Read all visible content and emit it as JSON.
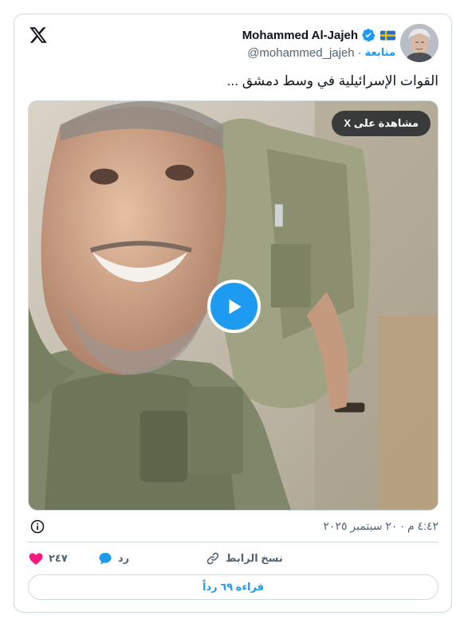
{
  "author": {
    "display_name": "Mohammed Al-Jajeh",
    "handle": "@mohammed_jajeh",
    "follow_label": "متابعة",
    "separator": "·"
  },
  "tweet": {
    "text": "القوات الإسرائيلية في وسط دمشق ..."
  },
  "media": {
    "watch_on_x_label": "مشاهدة على X"
  },
  "meta": {
    "timestamp": "٤:٤٢ م · ٢٠ سبتمبر ٢٠٢٥"
  },
  "actions": {
    "like_count": "٢٤٧",
    "reply_label": "رد",
    "copy_link_label": "نسخ الرابط"
  },
  "read_replies_label": "قراءة ٦٩ رداً",
  "colors": {
    "accent": "#1d9bf0",
    "like": "#f91880",
    "muted": "#536471",
    "border": "#cfd9de"
  },
  "icons": [
    "x-logo-icon",
    "verified-badge-icon",
    "sweden-flag-icon",
    "play-icon",
    "info-icon",
    "heart-icon",
    "reply-bubble-icon",
    "link-icon"
  ]
}
